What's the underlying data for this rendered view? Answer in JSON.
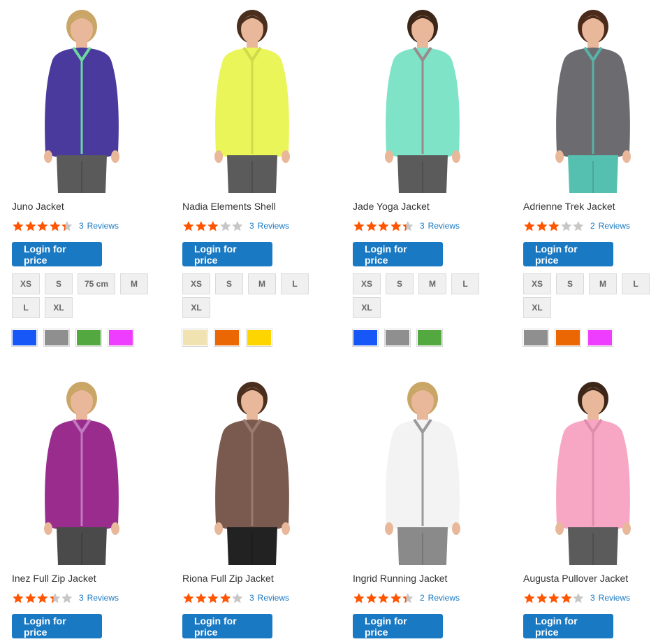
{
  "login_label": "Login for price",
  "products": [
    {
      "name": "Juno Jacket",
      "rating_percent": 87,
      "review_count": "3",
      "reviews_label": "Reviews",
      "sizes": [
        "XS",
        "S",
        "75 cm",
        "M",
        "L",
        "XL"
      ],
      "colors": [
        "#1857f7",
        "#8f8f8f",
        "#53a93f",
        "#ef3dff"
      ],
      "garment_color": "#4a3a9e",
      "accent_color": "#6ed6a0",
      "hair_color": "#c9a566",
      "pants_color": "#5a5a5a"
    },
    {
      "name": "Nadia Elements Shell",
      "rating_percent": 60,
      "review_count": "3",
      "reviews_label": "Reviews",
      "sizes": [
        "XS",
        "S",
        "M",
        "L",
        "XL"
      ],
      "colors": [
        "#f1e3b1",
        "#eb6703",
        "#ffd500"
      ],
      "garment_color": "#eaf55a",
      "accent_color": "#cfd94a",
      "hair_color": "#4a2e1e",
      "pants_color": "#5b5b5b"
    },
    {
      "name": "Jade Yoga Jacket",
      "rating_percent": 87,
      "review_count": "3",
      "reviews_label": "Reviews",
      "sizes": [
        "XS",
        "S",
        "M",
        "L",
        "XL"
      ],
      "colors": [
        "#1857f7",
        "#8f8f8f",
        "#53a93f"
      ],
      "garment_color": "#7fe3c8",
      "accent_color": "#9a8a8a",
      "hair_color": "#3b2618",
      "pants_color": "#5b5b5b"
    },
    {
      "name": "Adrienne Trek Jacket",
      "rating_percent": 60,
      "review_count": "2",
      "reviews_label": "Reviews",
      "sizes": [
        "XS",
        "S",
        "M",
        "L",
        "XL"
      ],
      "colors": [
        "#8f8f8f",
        "#eb6703",
        "#ef3dff"
      ],
      "garment_color": "#6b6b70",
      "accent_color": "#58b3a8",
      "hair_color": "#4a2a1a",
      "pants_color": "#56c0b0"
    },
    {
      "name": "Inez Full Zip Jacket",
      "rating_percent": 67,
      "review_count": "3",
      "reviews_label": "Reviews",
      "sizes": [],
      "colors": [],
      "garment_color": "#9a2c8e",
      "accent_color": "#c07ac0",
      "hair_color": "#c9a566",
      "pants_color": "#4a4a4a"
    },
    {
      "name": "Riona Full Zip Jacket",
      "rating_percent": 80,
      "review_count": "3",
      "reviews_label": "Reviews",
      "sizes": [],
      "colors": [],
      "garment_color": "#7a5a4e",
      "accent_color": "#9a7a6e",
      "hair_color": "#4a2e1e",
      "pants_color": "#222222"
    },
    {
      "name": "Ingrid Running Jacket",
      "rating_percent": 87,
      "review_count": "2",
      "reviews_label": "Reviews",
      "sizes": [],
      "colors": [],
      "garment_color": "#f3f3f3",
      "accent_color": "#9a9a9a",
      "hair_color": "#c9a566",
      "pants_color": "#8a8a8a"
    },
    {
      "name": "Augusta Pullover Jacket",
      "rating_percent": 80,
      "review_count": "3",
      "reviews_label": "Reviews",
      "sizes": [],
      "colors": [],
      "garment_color": "#f7a6c4",
      "accent_color": "#e08cab",
      "hair_color": "#3b2618",
      "pants_color": "#5b5b5b"
    }
  ]
}
